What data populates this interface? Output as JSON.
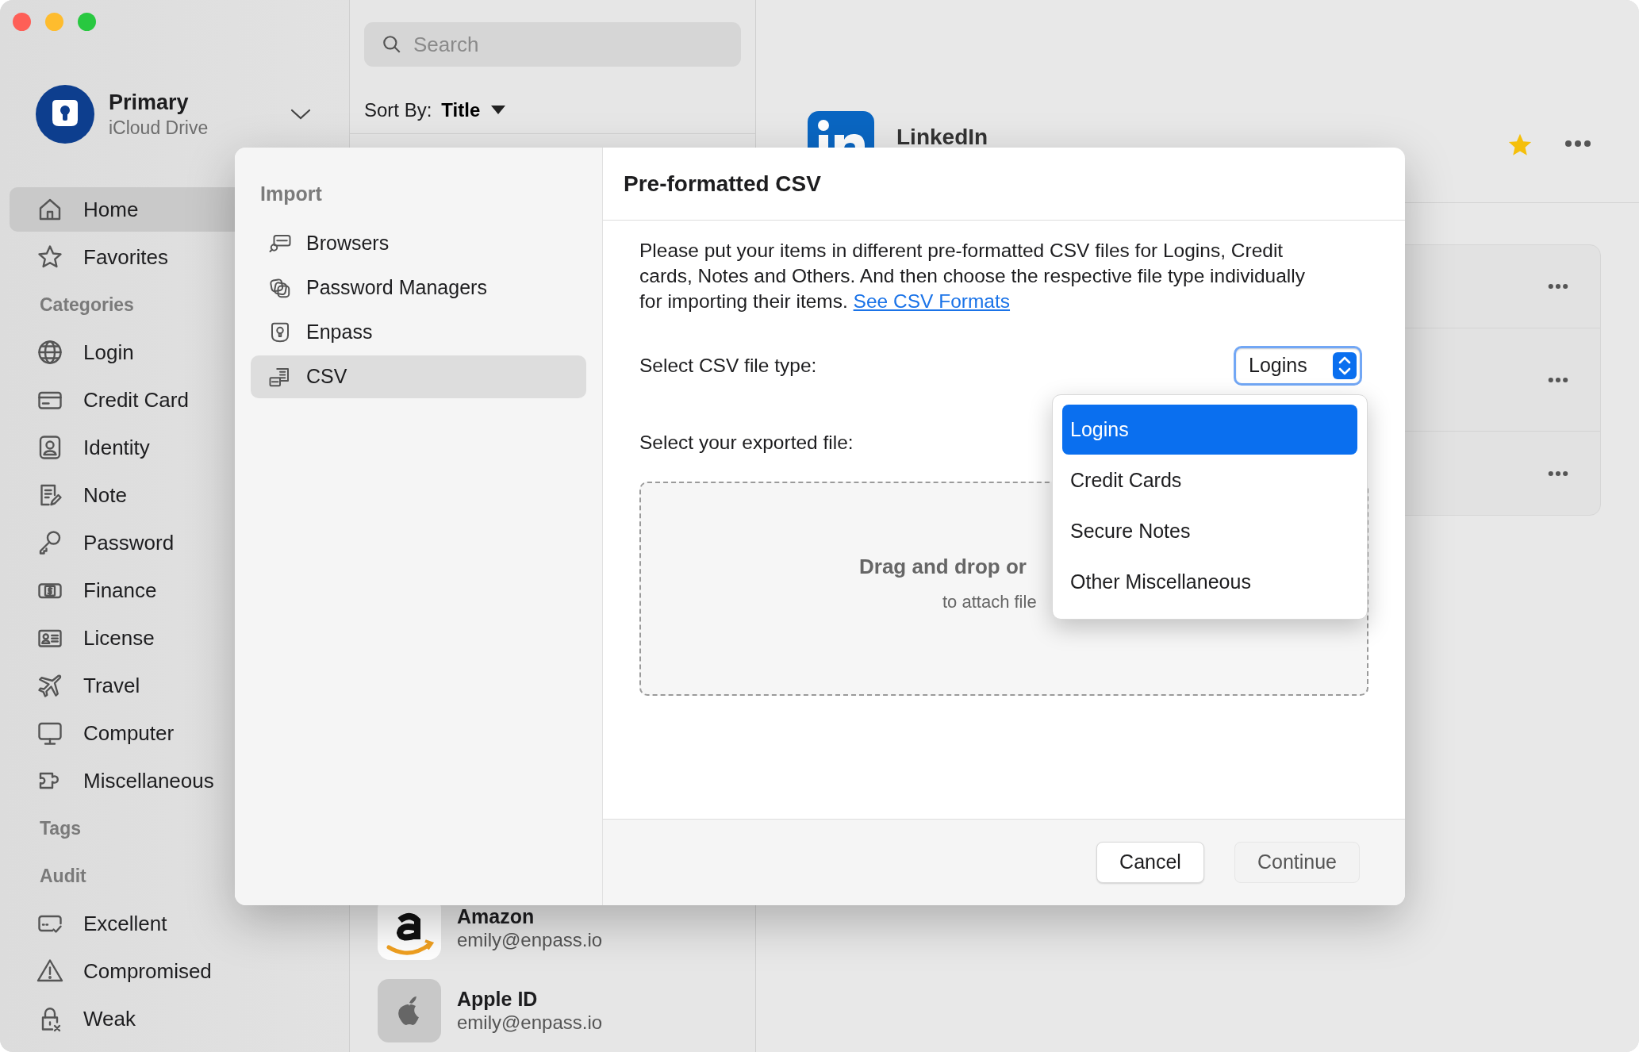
{
  "account": {
    "name": "Primary",
    "storage": "iCloud Drive"
  },
  "sidebar": {
    "sections": [
      {
        "items": [
          {
            "label": "Home",
            "selected": true
          },
          {
            "label": "Favorites",
            "selected": false
          }
        ]
      },
      {
        "title": "Categories",
        "items": [
          {
            "label": "Login",
            "selected": false
          },
          {
            "label": "Credit Card",
            "selected": false
          },
          {
            "label": "Identity",
            "selected": false
          },
          {
            "label": "Note",
            "selected": false
          },
          {
            "label": "Password",
            "selected": false
          },
          {
            "label": "Finance",
            "selected": false
          },
          {
            "label": "License",
            "selected": false
          },
          {
            "label": "Travel",
            "selected": false
          },
          {
            "label": "Computer",
            "selected": false
          },
          {
            "label": "Miscellaneous",
            "selected": false
          }
        ]
      },
      {
        "title": "Tags"
      },
      {
        "title": "Audit",
        "items": [
          {
            "label": "Excellent",
            "selected": false
          },
          {
            "label": "Compromised",
            "selected": false
          },
          {
            "label": "Weak",
            "selected": false
          }
        ]
      }
    ]
  },
  "search": {
    "placeholder": "Search"
  },
  "sort": {
    "label": "Sort By:",
    "value": "Title"
  },
  "list_items": [
    {
      "title": "Amazon",
      "subtitle": "emily@enpass.io"
    },
    {
      "title": "Apple ID",
      "subtitle": "emily@enpass.io"
    }
  ],
  "detail": {
    "title": "LinkedIn",
    "favorite": true
  },
  "dialog": {
    "sidebar_title": "Import",
    "sources": [
      {
        "label": "Browsers",
        "selected": false
      },
      {
        "label": "Password Managers",
        "selected": false
      },
      {
        "label": "Enpass",
        "selected": false
      },
      {
        "label": "CSV",
        "selected": true
      }
    ],
    "title": "Pre-formatted CSV",
    "description": "Please put your items in different pre-formatted CSV files for Logins, Credit cards, Notes and Others. And then choose the respective file type individually for importing their items.",
    "link": "See CSV Formats",
    "file_type_label": "Select CSV file type:",
    "file_type_value": "Logins",
    "file_label": "Select your exported file:",
    "drop_title": "Drag and drop or",
    "drop_hint": "to attach file",
    "buttons": [
      {
        "label": "Cancel",
        "disabled": false
      },
      {
        "label": "Continue",
        "disabled": true
      }
    ]
  },
  "dropdown": {
    "options": [
      {
        "label": "Logins",
        "selected": true
      },
      {
        "label": "Credit Cards",
        "selected": false
      },
      {
        "label": "Secure Notes",
        "selected": false
      },
      {
        "label": "Other Miscellaneous",
        "selected": false
      }
    ]
  }
}
